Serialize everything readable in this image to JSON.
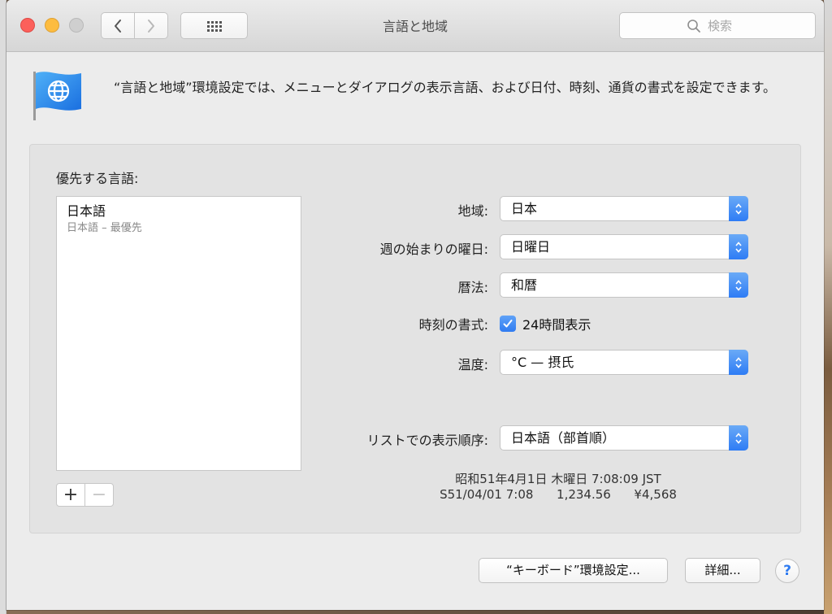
{
  "window": {
    "title": "言語と地域"
  },
  "search": {
    "placeholder": "検索"
  },
  "description": "“言語と地域”環境設定では、メニューとダイアログの表示言語、および日付、時刻、通貨の書式を設定できます。",
  "languages": {
    "title": "優先する言語:",
    "items": [
      {
        "name": "日本語",
        "subtitle": "日本語 – 最優先"
      }
    ],
    "add_label": "+",
    "remove_label": "−"
  },
  "settings": {
    "region": {
      "label": "地域:",
      "value": "日本"
    },
    "first_day": {
      "label": "週の始まりの曜日:",
      "value": "日曜日"
    },
    "calendar": {
      "label": "暦法:",
      "value": "和暦"
    },
    "time_format": {
      "label": "時刻の書式:",
      "checkbox_label": "24時間表示",
      "checked": true
    },
    "temperature": {
      "label": "温度:",
      "value": "°C — 摂氏"
    },
    "list_order": {
      "label": "リストでの表示順序:",
      "value": "日本語（部首順）"
    }
  },
  "sample": {
    "line1": "昭和51年4月1日 木曜日 7:08:09 JST",
    "line2": "S51/04/01 7:08      1,234.56      ¥4,568"
  },
  "buttons": {
    "keyboard": "“キーボード”環境設定...",
    "advanced": "詳細...",
    "help": "?"
  },
  "colors": {
    "accent": "#2f7bf1",
    "close": "#fc605b",
    "minimize": "#fdbc40"
  }
}
